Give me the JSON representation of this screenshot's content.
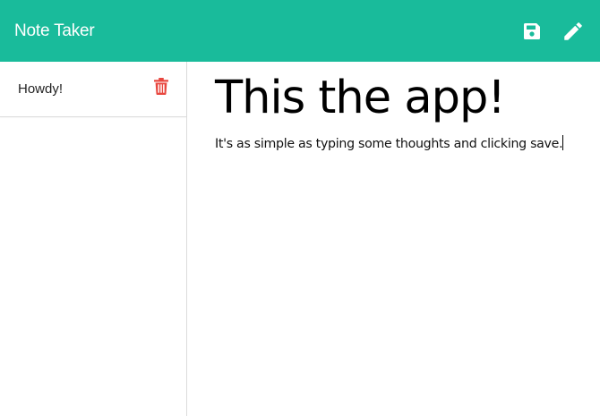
{
  "app": {
    "brand": "Note Taker",
    "accent_color": "#19bb9b"
  },
  "toolbar": {
    "save_icon": "save-icon",
    "new_note_icon": "pencil-icon"
  },
  "sidebar": {
    "items": [
      {
        "title": "Howdy!",
        "delete_icon": "trash-icon"
      }
    ],
    "delete_color": "#e8473f"
  },
  "editor": {
    "title": "This the app!",
    "text": "It's as simple as typing some thoughts and clicking save."
  }
}
